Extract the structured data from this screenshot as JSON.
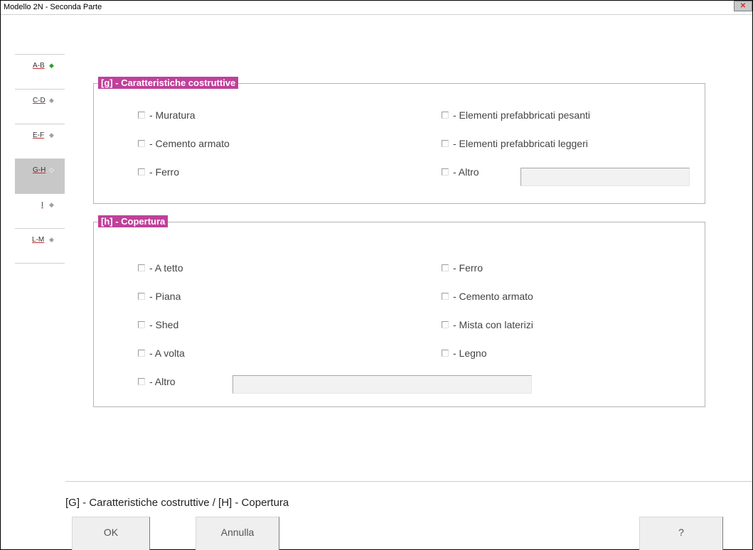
{
  "window": {
    "title": "Modello 2N - Seconda Parte",
    "close_label": "✕"
  },
  "tabs": [
    {
      "label": "A-B",
      "active": false
    },
    {
      "label": "C-D",
      "active": false
    },
    {
      "label": "E-F",
      "active": false
    },
    {
      "label": "G-H",
      "active": true
    },
    {
      "label": "I",
      "active": false
    },
    {
      "label": "L-M",
      "active": false
    }
  ],
  "group_g": {
    "title": "[g] - Caratteristiche costruttive",
    "left": [
      "- Muratura",
      "- Cemento armato",
      "- Ferro"
    ],
    "right": [
      "- Elementi prefabbricati pesanti",
      "- Elementi prefabbricati leggeri",
      "- Altro"
    ],
    "altro_value": ""
  },
  "group_h": {
    "title": "[h] - Copertura",
    "left": [
      "- A tetto",
      "- Piana",
      "- Shed",
      "- A volta",
      "- Altro"
    ],
    "right": [
      "- Ferro",
      "- Cemento armato",
      "- Mista con laterizi",
      "- Legno"
    ],
    "altro_value": ""
  },
  "status_text": "[G] - Caratteristiche costruttive / [H] - Copertura",
  "buttons": {
    "ok": "OK",
    "cancel": "Annulla",
    "help": "?"
  },
  "colors": {
    "legend_bg": "#c0409a",
    "active_tab": "#c8c8c8",
    "first_tab_dot": "#2fa02f"
  }
}
